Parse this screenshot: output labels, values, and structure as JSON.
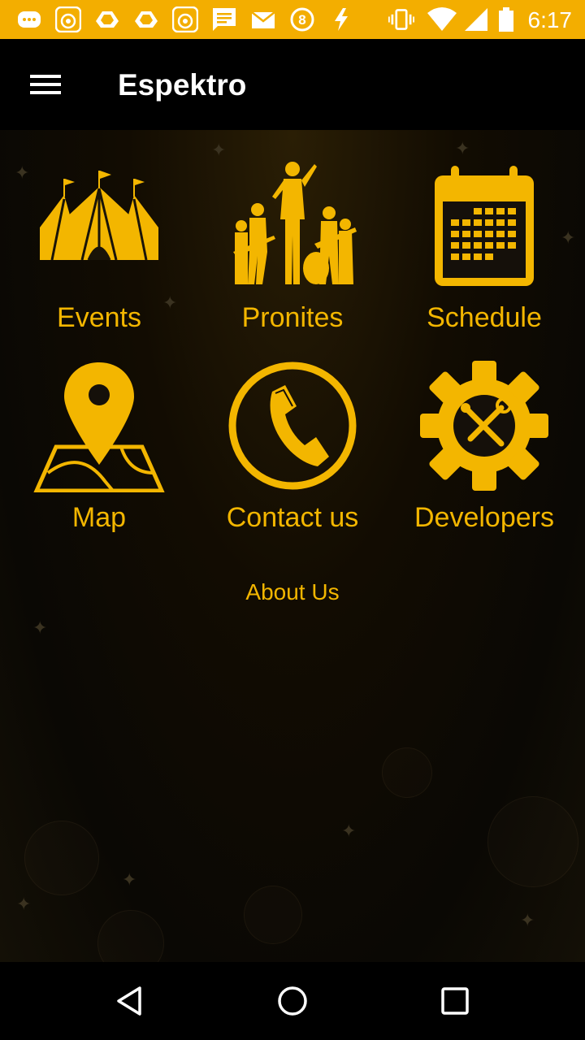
{
  "status_bar": {
    "time": "6:17",
    "background": "#F3AE00",
    "left_icons": [
      "chat-icon",
      "lottery-icon",
      "drive-icon",
      "drive-icon",
      "lottery-icon",
      "message-icon",
      "mail-icon",
      "badge-8-icon",
      "flash-icon"
    ],
    "right_icons": [
      "vibrate-icon",
      "wifi-icon",
      "signal-icon",
      "battery-icon"
    ]
  },
  "app_bar": {
    "title": "Espektro",
    "menu_icon": "hamburger-menu-icon"
  },
  "tiles": [
    {
      "label": "Events",
      "icon": "circus-tent-icon"
    },
    {
      "label": "Pronites",
      "icon": "band-silhouette-icon"
    },
    {
      "label": "Schedule",
      "icon": "calendar-icon"
    },
    {
      "label": "Map",
      "icon": "map-pin-icon"
    },
    {
      "label": "Contact us",
      "icon": "phone-icon"
    },
    {
      "label": "Developers",
      "icon": "tools-gear-icon"
    }
  ],
  "about_link": "About Us",
  "accent_color": "#F3B600",
  "nav_bar": {
    "buttons": [
      "back-icon",
      "home-icon",
      "recents-icon"
    ]
  }
}
